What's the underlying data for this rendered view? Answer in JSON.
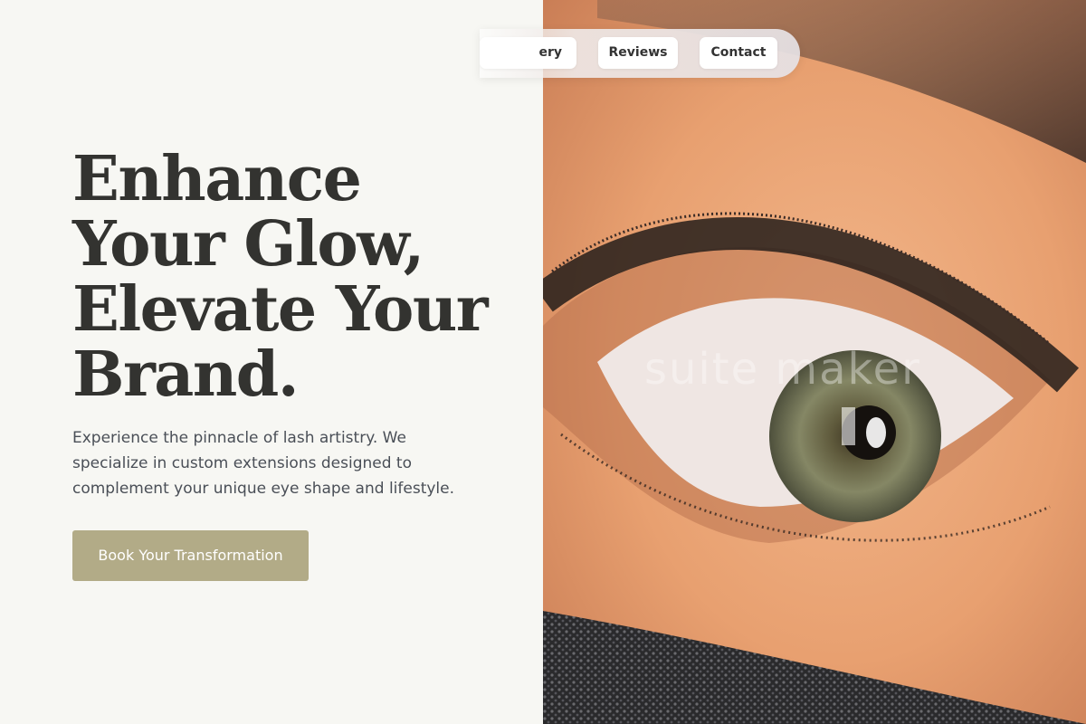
{
  "hero": {
    "headline": "Enhance Your Glow, Elevate Your Brand.",
    "description": "Experience the pinnacle of lash artistry. We specialize in custom extensions designed to complement your unique eye shape and lifestyle.",
    "cta_label": "Book Your Transformation",
    "image_watermark": "suite maker"
  },
  "nav": {
    "items": [
      {
        "label": "ery"
      },
      {
        "label": "Reviews"
      },
      {
        "label": "Contact"
      }
    ]
  },
  "colors": {
    "background": "#f7f7f3",
    "heading": "#333330",
    "body_text": "#4a4f57",
    "accent": "#b2ab87"
  }
}
